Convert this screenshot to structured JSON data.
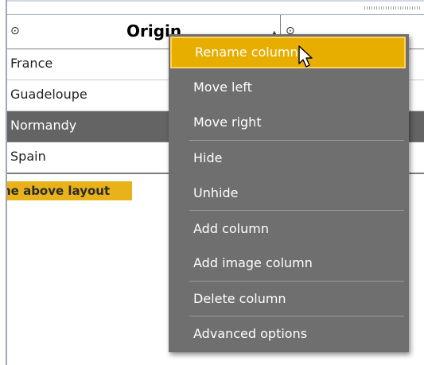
{
  "header": {
    "column_title": "Origin",
    "visibility_icon": "eye-icon",
    "sort_icon": "sort-up-icon"
  },
  "rows": [
    "France",
    "Guadeloupe",
    "Normandy",
    "Spain"
  ],
  "selected_row": "Normandy",
  "layout_banner": "he above layout",
  "context_menu": {
    "items": [
      {
        "label": "Rename column",
        "active": true
      },
      {
        "label": "Move left"
      },
      {
        "label": "Move right"
      },
      {
        "label": "Hide"
      },
      {
        "label": "Unhide"
      },
      {
        "label": "Add column"
      },
      {
        "label": "Add image column"
      },
      {
        "label": "Delete column"
      },
      {
        "label": "Advanced options"
      }
    ]
  },
  "colors": {
    "menu_bg": "#6f6f6f",
    "menu_active": "#e7ae00",
    "selected_row": "#646464",
    "banner": "#e8b21a"
  }
}
